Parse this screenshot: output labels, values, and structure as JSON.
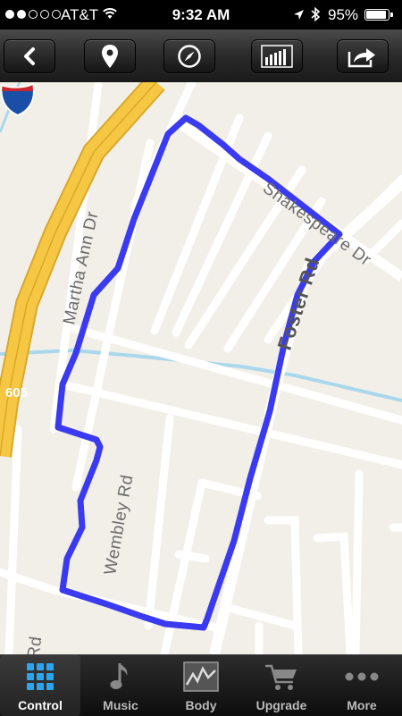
{
  "status_bar": {
    "carrier": "AT&T",
    "time": "9:32 AM",
    "battery_percent": "95%",
    "battery_level": 0.95,
    "signal_bars_filled": 2,
    "signal_bars_total": 5
  },
  "toolbar": {
    "buttons": [
      "back-chevron-icon",
      "location-pin-icon",
      "compass-icon",
      "bar-chart-icon",
      "share-icon"
    ]
  },
  "map": {
    "streets": {
      "martha_ann": "Martha Ann Dr",
      "shakespeare": "Shakespeare Dr",
      "foster": "Foster Rd",
      "wembley": "Wembley Rd",
      "partial_rd": "Rd"
    },
    "highway_shield": "605",
    "colors": {
      "background": "#f2efe9",
      "route": "#3a3af0",
      "highway": "#f6c743",
      "water": "#9fd3ea"
    }
  },
  "tabbar": {
    "tabs": [
      {
        "label": "Control",
        "icon": "grid-icon",
        "active": true
      },
      {
        "label": "Music",
        "icon": "music-note-icon",
        "active": false
      },
      {
        "label": "Body",
        "icon": "body-graph-icon",
        "active": false
      },
      {
        "label": "Upgrade",
        "icon": "cart-icon",
        "active": false
      },
      {
        "label": "More",
        "icon": "more-dots-icon",
        "active": false
      }
    ]
  }
}
